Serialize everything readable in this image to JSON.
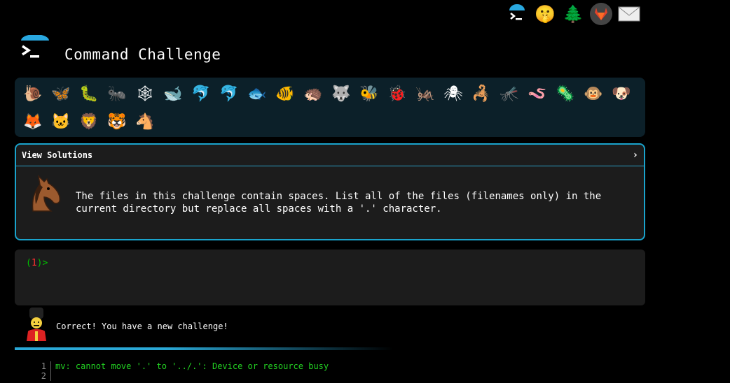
{
  "top_icons": [
    {
      "name": "terminal-logo-icon",
      "glyph": ">_"
    },
    {
      "name": "shush-face-icon",
      "glyph": "🤫"
    },
    {
      "name": "tree-icon",
      "glyph": "🌲"
    },
    {
      "name": "gitlab-icon",
      "glyph": "🦊"
    },
    {
      "name": "mail-icon",
      "glyph": "✉"
    }
  ],
  "header": {
    "title": "Command Challenge"
  },
  "animals": [
    "🐌",
    "🦋",
    "🐛",
    "🐜",
    "🕸",
    "🐋",
    "🐬",
    "🐬",
    "🐟",
    "🐠",
    "🦔",
    "🐺",
    "🐝",
    "🐞",
    "🦗",
    "🕷",
    "🦂",
    "🦟",
    "🪱",
    "🦠",
    "🐵",
    "🐶",
    "🦊",
    "🐱",
    "🦁",
    "🐯",
    "🐴"
  ],
  "challenge": {
    "view_solutions_label": "View Solutions",
    "chevron": "›",
    "text": "The files in this challenge contain spaces. List all of the files (filenames only) in the current directory but replace all spaces with a '.' character."
  },
  "terminal": {
    "paren_open": "(",
    "number": "1",
    "paren_close": ")",
    "caret": ">"
  },
  "message": {
    "text": "Correct! You have a new challenge!"
  },
  "output": {
    "lines": [
      {
        "num": "1",
        "text": "mv: cannot move '.' to '../.': Device or resource busy"
      },
      {
        "num": "2",
        "text": ""
      }
    ]
  }
}
